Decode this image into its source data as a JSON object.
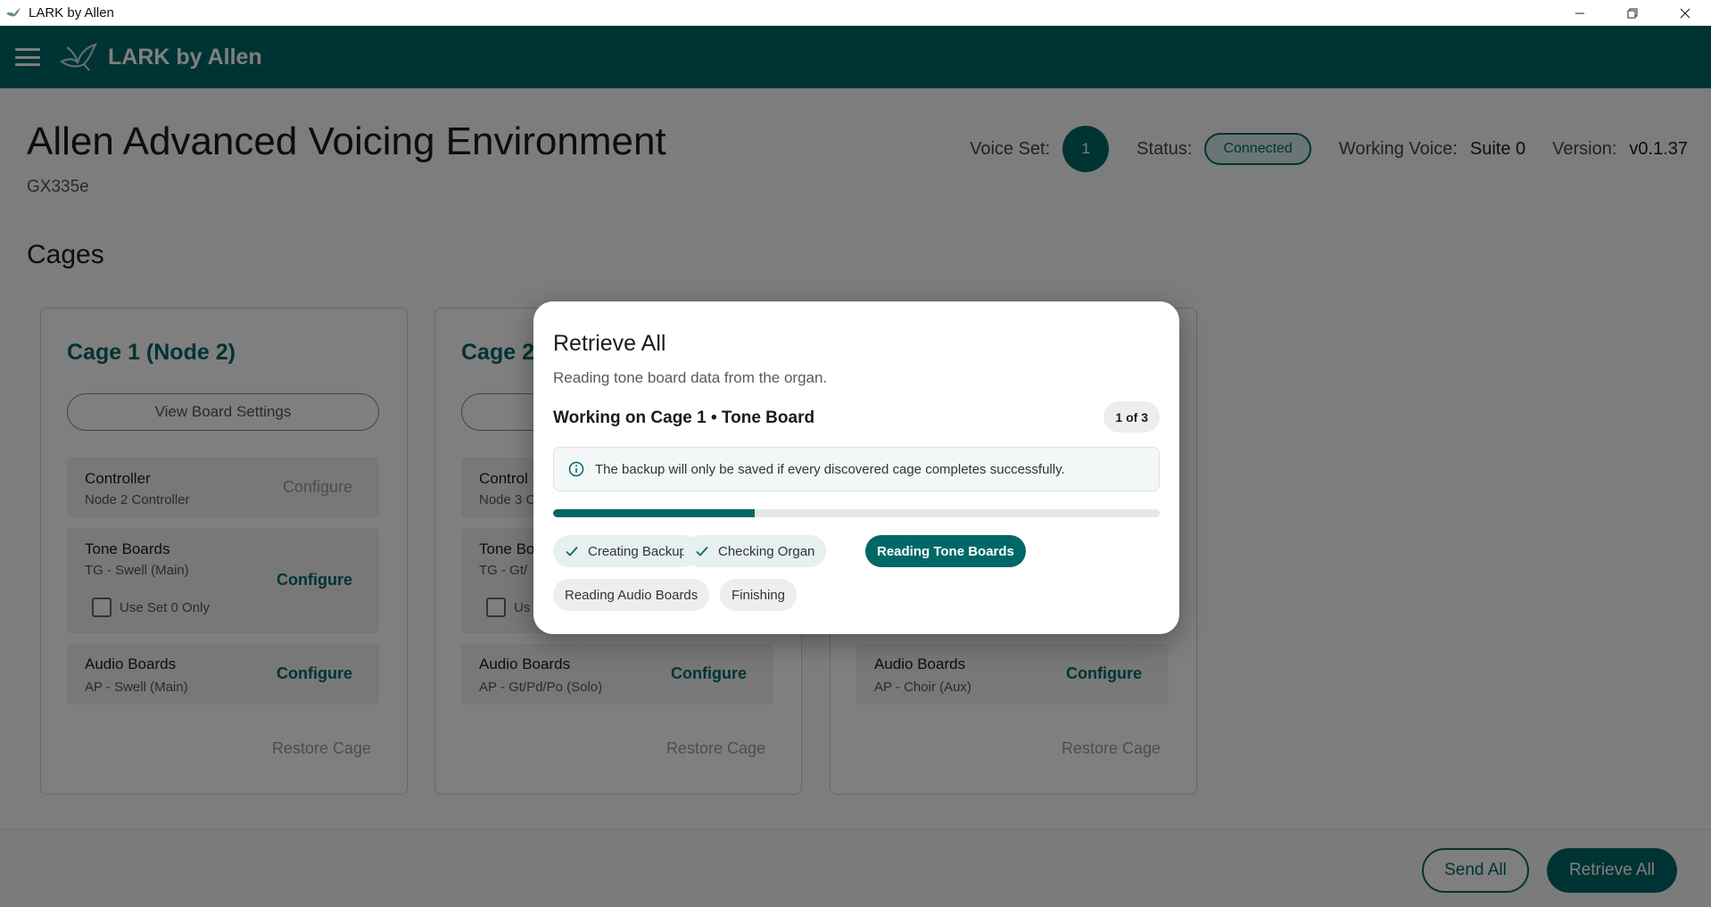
{
  "window": {
    "title": "LARK by Allen",
    "minimize_icon": "minimize-icon",
    "maximize_icon": "restore-icon",
    "close_icon": "close-icon"
  },
  "appbar": {
    "menu_icon": "hamburger-menu-icon",
    "logo_icon": "bird-logo-icon",
    "title": "LARK by Allen",
    "color": "#006767"
  },
  "header": {
    "title": "Allen Advanced Voicing Environment",
    "model": "GX335e",
    "voice_set_label": "Voice Set:",
    "voice_set_value": "1",
    "status_label": "Status:",
    "status_value": "Connected",
    "working_voice_label": "Working Voice:",
    "working_voice_value": "Suite 0",
    "version_label": "Version:",
    "version_value": "v0.1.37"
  },
  "cages_section": {
    "title": "Cages",
    "cages": [
      {
        "title": "Cage 1 (Node 2)",
        "board_settings_label": "View Board Settings",
        "controller_title": "Controller",
        "controller_sub": "Node 2 Controller",
        "controller_action": "Configure",
        "tone_title": "Tone Boards",
        "tone_sub": "TG - Swell (Main)",
        "tone_action": "Configure",
        "checkbox_label": "Use Set 0 Only",
        "audio_title": "Audio Boards",
        "audio_sub": "AP - Swell (Main)",
        "audio_action": "Configure",
        "restore_label": "Restore Cage"
      },
      {
        "title": "Cage 2",
        "controller_title": "Control",
        "controller_sub": "Node 3 C",
        "tone_title": "Tone Bo",
        "tone_sub": "TG - Gt/",
        "checkbox_label": "Us",
        "audio_title": "Audio Boards",
        "audio_sub": "AP - Gt/Pd/Po (Solo)",
        "audio_action": "Configure",
        "restore_label": "Restore Cage"
      },
      {
        "audio_title": "Audio Boards",
        "audio_sub": "AP - Choir (Aux)",
        "audio_action": "Configure",
        "restore_label": "Restore Cage"
      }
    ]
  },
  "footer": {
    "send_all": "Send All",
    "retrieve_all": "Retrieve All"
  },
  "dialog": {
    "title": "Retrieve All",
    "subtitle": "Reading tone board data from the organ.",
    "current_step": "Working on Cage 1 • Tone Board",
    "step_count": "1 of 3",
    "info_icon": "info-icon",
    "note": "The backup will only be saved if every discovered cage completes successfully.",
    "progress": 0.333,
    "steps": [
      {
        "label": "Creating Backup",
        "state": "done"
      },
      {
        "label": "Checking Organ",
        "state": "done"
      },
      {
        "label": "Reading Tone Boards",
        "state": "active"
      },
      {
        "label": "Reading Audio Boards",
        "state": "pending"
      },
      {
        "label": "Finishing",
        "state": "pending"
      }
    ]
  }
}
